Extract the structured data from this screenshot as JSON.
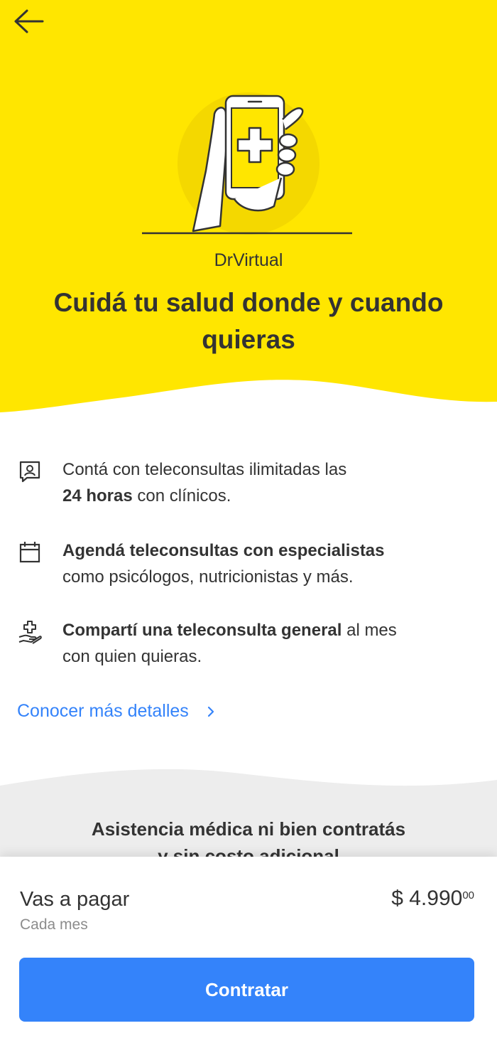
{
  "header": {
    "back_icon": "arrow-left-icon",
    "hero_color": "#ffe600"
  },
  "hero": {
    "brand": "DrVirtual",
    "title": "Cuidá tu salud donde y cuando quieras",
    "illustration_icon": "phone-medical-cross-icon"
  },
  "benefits": [
    {
      "icon": "chat-doctor-icon",
      "bold": "",
      "text_a": "Contá con teleconsultas ilimitadas las",
      "strong": "24 horas",
      "text_b": " con clínicos."
    },
    {
      "icon": "calendar-icon",
      "bold": "Agendá teleconsultas con especialistas",
      "text_b": "como psicólogos, nutricionistas y más."
    },
    {
      "icon": "hand-plus-icon",
      "bold": "Compartí una teleconsulta general",
      "text_a": " al mes",
      "text_b": "con quien quieras."
    }
  ],
  "details_link": {
    "label": "Conocer más detalles",
    "icon": "chevron-right-icon"
  },
  "promo": {
    "title_line1": "Asistencia médica ni bien contratás",
    "title_line2": "y sin costo adicional"
  },
  "footer": {
    "pay_label": "Vas a pagar",
    "pay_period": "Cada mes",
    "price_main": "$ 4.990",
    "price_cents": "00",
    "cta_label": "Contratar",
    "cta_color": "#3483fa"
  }
}
